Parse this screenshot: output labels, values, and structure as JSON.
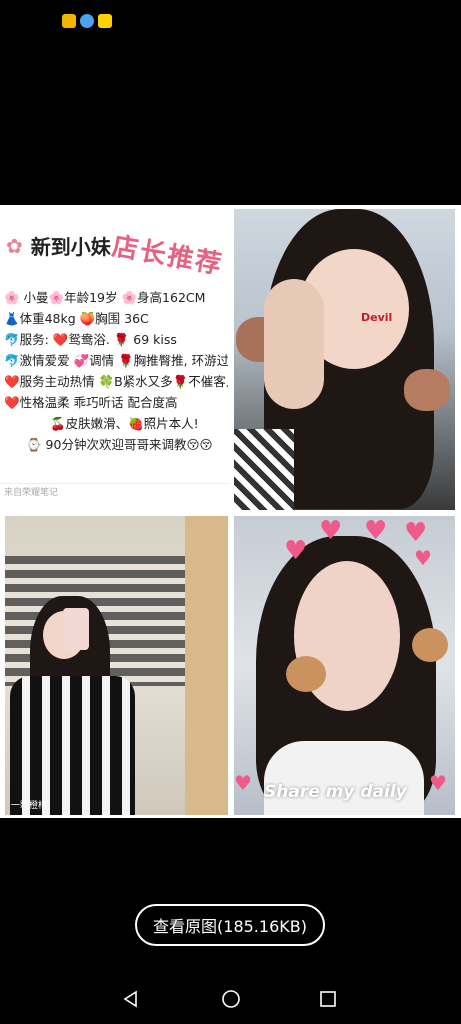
{
  "status_bar": {
    "icons": [
      {
        "name": "app-icon-a",
        "color": "#f4b400"
      },
      {
        "name": "app-icon-b",
        "color": "#4aa3f0"
      },
      {
        "name": "meituan-icon",
        "color": "#ffd100"
      }
    ]
  },
  "post": {
    "title": "新到小妹",
    "stamp": "店长推荐",
    "lines": [
      "🌸 小曼🌸年龄19岁 🌸身高162CM",
      "👗体重48kg 🍑胸围 36C",
      "🐬服务: ❤️鸳鸯浴. 🌹 69 kiss",
      "🐬激情爱爱 💞调情 🌹胸推臀推, 环游过水",
      "❤️服务主动热情 🍀B紧水又多🌹不催客人",
      "❤️性格温柔 乖巧听话 配合度高",
      "🍒皮肤嫩滑、🍓照片本人!",
      "⌚ 90分钟次欢迎哥哥来调教😚😚"
    ],
    "source": "来自荣耀笔记",
    "photo1_sticker": "Devil",
    "photo2_watermark": "一颗橙柿",
    "photo3_caption": "Share my daily"
  },
  "view_original_button": "查看原图(185.16KB)",
  "nav": {
    "back": "◁",
    "home": "○",
    "recent": "□"
  },
  "colors": {
    "accent_pink": "#e23b63",
    "background": "#000000"
  }
}
